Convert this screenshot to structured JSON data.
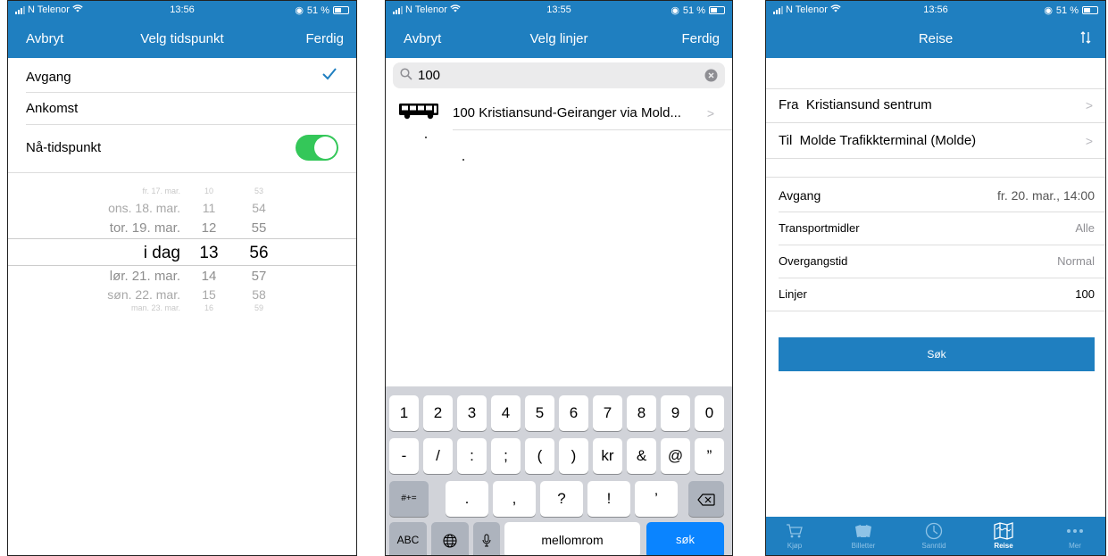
{
  "statusbars": [
    {
      "carrier": "N Telenor",
      "time": "13:56",
      "battery": "51 %"
    },
    {
      "carrier": "N Telenor",
      "time": "13:55",
      "battery": "51 %"
    },
    {
      "carrier": "N Telenor",
      "time": "13:56",
      "battery": "51 %"
    }
  ],
  "screen1": {
    "nav": {
      "left": "Avbryt",
      "title": "Velg tidspunkt",
      "right": "Ferdig"
    },
    "option_departure": "Avgang",
    "option_arrival": "Ankomst",
    "now_label": "Nå-tidspunkt",
    "now_toggle": true,
    "picker": {
      "rows": [
        {
          "day": "fr. 17. mar.",
          "hour": "10",
          "min": "53"
        },
        {
          "day": "ons. 18. mar.",
          "hour": "11",
          "min": "54"
        },
        {
          "day": "tor. 19. mar.",
          "hour": "12",
          "min": "55"
        },
        {
          "day": "i dag",
          "hour": "13",
          "min": "56"
        },
        {
          "day": "lør. 21. mar.",
          "hour": "14",
          "min": "57"
        },
        {
          "day": "søn. 22. mar.",
          "hour": "15",
          "min": "58"
        },
        {
          "day": "man. 23. mar.",
          "hour": "16",
          "min": "59"
        }
      ]
    }
  },
  "screen2": {
    "nav": {
      "left": "Avbryt",
      "title": "Velg linjer",
      "right": "Ferdig"
    },
    "search_value": "100",
    "result": "100 Kristiansund-Geiranger via Mold...",
    "keyboard": {
      "row1": [
        "1",
        "2",
        "3",
        "4",
        "5",
        "6",
        "7",
        "8",
        "9",
        "0"
      ],
      "row2": [
        "-",
        "/",
        ":",
        ";",
        "(",
        ")",
        "kr",
        "&",
        "@",
        "”"
      ],
      "row3": [
        ".",
        ",",
        "?",
        "!",
        "’"
      ],
      "shift_label": "#+=",
      "abc_label": "ABC",
      "space_label": "mellomrom",
      "search_label": "søk"
    }
  },
  "screen3": {
    "nav": {
      "title": "Reise"
    },
    "from_prefix": "Fra",
    "from_value": "Kristiansund sentrum",
    "to_prefix": "Til",
    "to_value": "Molde Trafikkterminal (Molde)",
    "departure_label": "Avgang",
    "departure_value": "fr. 20. mar., 14:00",
    "transport_label": "Transportmidler",
    "transport_value": "Alle",
    "transfer_label": "Overgangstid",
    "transfer_value": "Normal",
    "lines_label": "Linjer",
    "lines_value": "100",
    "search_button": "Søk",
    "tabs": [
      {
        "label": "Kjøp",
        "icon": "cart-icon"
      },
      {
        "label": "Billetter",
        "icon": "tickets-icon"
      },
      {
        "label": "Sanntid",
        "icon": "clock-icon"
      },
      {
        "label": "Reise",
        "icon": "map-icon"
      },
      {
        "label": "Mer",
        "icon": "more-icon"
      }
    ],
    "active_tab": "Reise"
  },
  "colors": {
    "brand": "#1f7fc0",
    "toggle_on": "#34c759",
    "checkmark": "#1f7fc0",
    "key_blue": "#0a84ff"
  }
}
